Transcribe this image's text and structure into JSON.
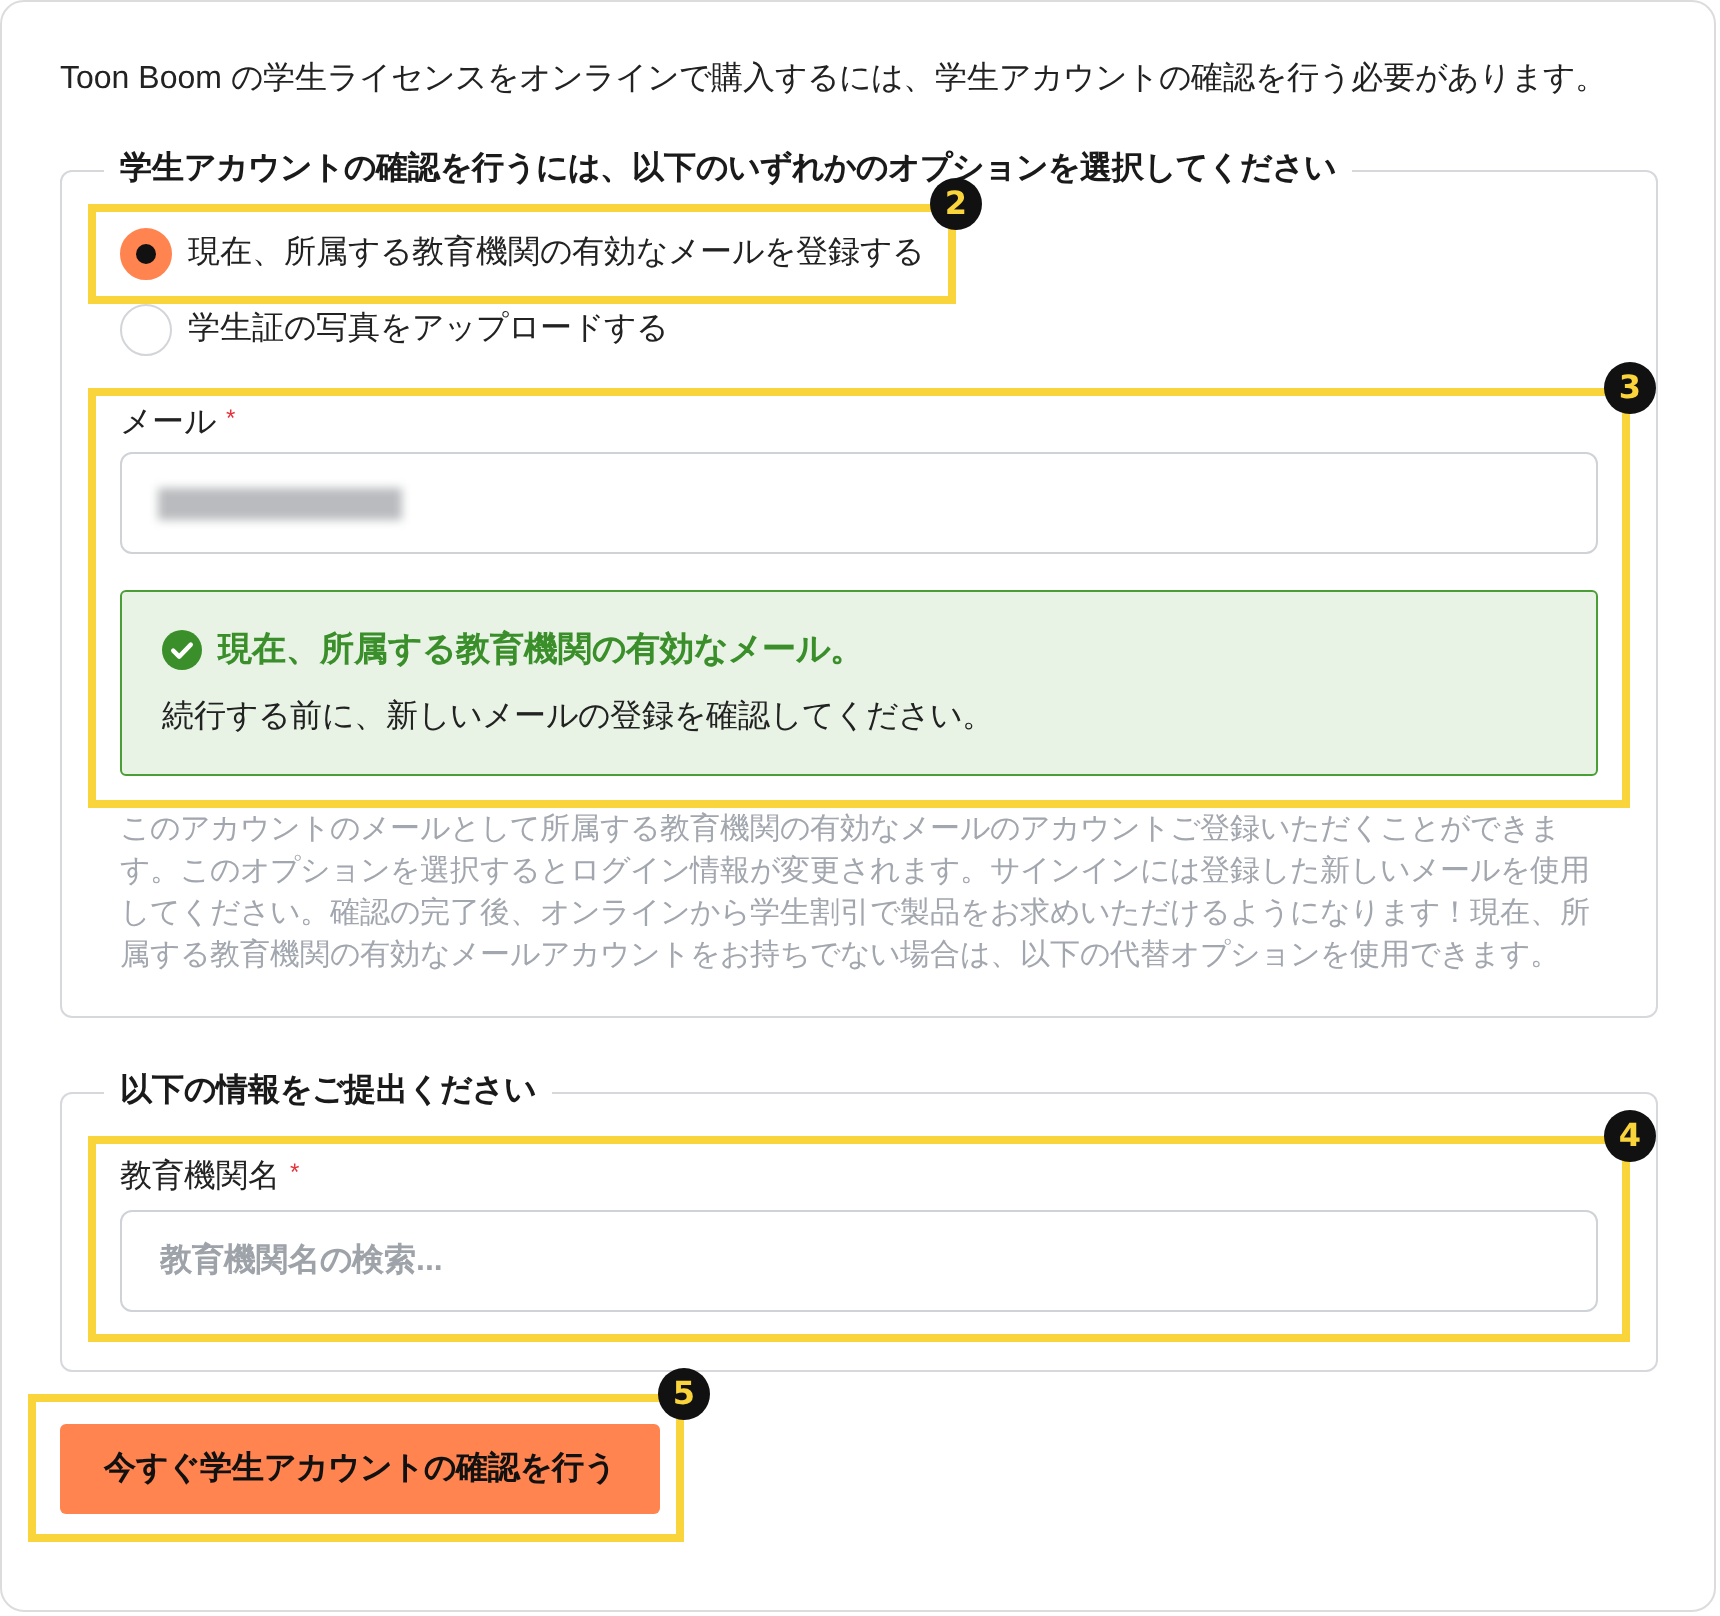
{
  "intro": "Toon Boom の学生ライセンスをオンラインで購入するには、学生アカウントの確認を行う必要があります。",
  "verification": {
    "legend": "学生アカウントの確認を行うには、以下のいずれかのオプションを選択してください",
    "options": [
      {
        "label": "現在、所属する教育機関の有効なメールを登録する",
        "selected": true,
        "callout": "2"
      },
      {
        "label": "学生証の写真をアップロードする",
        "selected": false
      }
    ],
    "email_group": {
      "callout": "3",
      "field": {
        "label": "メール",
        "required_mark": "*",
        "redacted": true
      },
      "notice": {
        "kind": "success",
        "title": "現在、所属する教育機関の有効なメール。",
        "message": "続行する前に、新しいメールの登録を確認してください。"
      }
    },
    "help_text": "このアカウントのメールとして所属する教育機関の有効なメールのアカウントご登録いただくことができます。このオプションを選択するとログイン情報が変更されます。サインインには登録した新しいメールを使用してください。確認の完了後、オンラインから学生割引で製品をお求めいただけるようになります！現在、所属する教育機関の有効なメールアカウントをお持ちでない場合は、以下の代替オプションを使用できます。"
  },
  "institution": {
    "legend": "以下の情報をご提出ください",
    "callout": "4",
    "field": {
      "label": "教育機関名",
      "required_mark": "*",
      "placeholder": "教育機関名の検索..."
    }
  },
  "submit_button": {
    "label": "今すぐ学生アカウントの確認を行う",
    "callout": "5"
  }
}
